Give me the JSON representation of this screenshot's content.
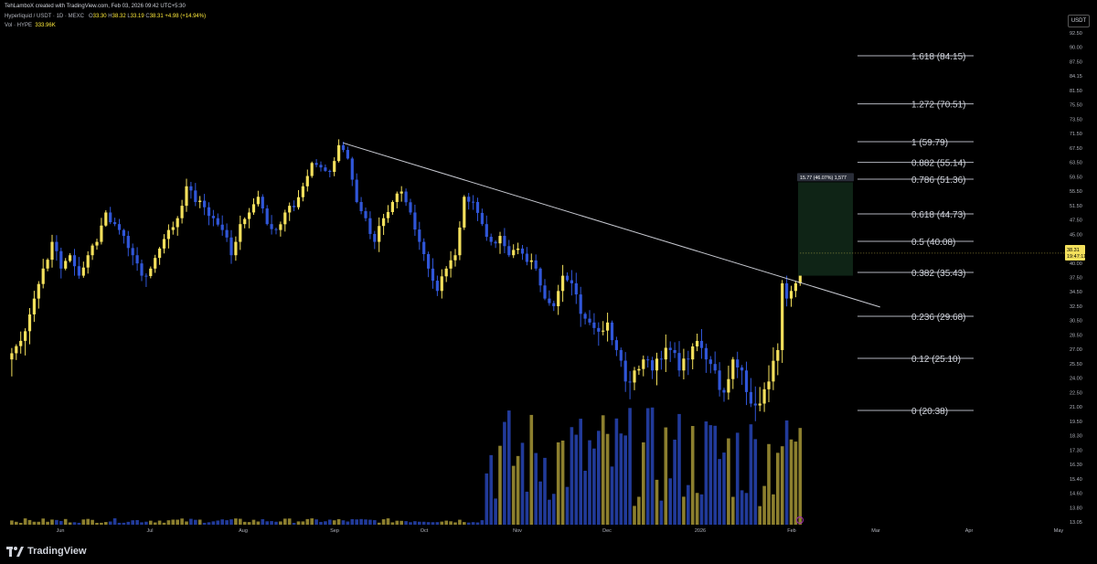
{
  "header": {
    "credit": "TehLamboX created with TradingView.com, Feb 03, 2026 09:42 UTC+5:30",
    "symbol": "Hyperliquid / USDT · 1D · MEXC",
    "ohlc": {
      "open_label": "O",
      "open": "33.30",
      "high_label": "H",
      "high": "38.32",
      "low_label": "L",
      "low": "33.19",
      "close_label": "C",
      "close": "38.31",
      "change": "+4.98 (+14.94%)"
    },
    "volume_label": "Vol · HYPE",
    "volume_value": "333.96K"
  },
  "currency": "USDT",
  "footer": {
    "brand": "TradingView"
  },
  "colors": {
    "up": "#f3e05c",
    "down": "#3056d8",
    "vol_up": "#8c7f2e",
    "vol_down": "#213a99",
    "fib_line": "#b2b5be",
    "trendline": "#c7c9d1",
    "measure_fill": "#0f2416",
    "price_tag": "#f3e05c"
  },
  "chart_data": {
    "type": "candlestick",
    "price_axis": {
      "ticks": [
        "92.50",
        "90.00",
        "87.50",
        "84.15",
        "81.50",
        "75.50",
        "73.50",
        "71.50",
        "67.50",
        "63.50",
        "59.50",
        "55.50",
        "51.50",
        "47.50",
        "45.00",
        "42.50",
        "40.00",
        "37.50",
        "34.50",
        "32.50",
        "30.50",
        "28.50",
        "27.00",
        "25.50",
        "24.00",
        "22.50",
        "21.00",
        "19.50",
        "18.30",
        "17.30",
        "16.30",
        "15.40",
        "14.60",
        "13.80",
        "13.05"
      ]
    },
    "time_axis": {
      "labels": [
        "Jun",
        "Jul",
        "Aug",
        "Sep",
        "Oct",
        "Nov",
        "Dec",
        "2026",
        "Feb",
        "Mar",
        "Apr",
        "May"
      ]
    },
    "candle_path": [
      [
        0,
        25
      ],
      [
        3,
        27
      ],
      [
        6,
        32
      ],
      [
        10,
        40
      ],
      [
        12,
        36
      ],
      [
        14,
        38
      ],
      [
        16,
        35
      ],
      [
        18,
        38
      ],
      [
        20,
        40
      ],
      [
        22,
        45
      ],
      [
        24,
        43
      ],
      [
        26,
        41
      ],
      [
        28,
        38
      ],
      [
        30,
        35
      ],
      [
        32,
        36
      ],
      [
        34,
        39
      ],
      [
        36,
        42
      ],
      [
        38,
        44
      ],
      [
        40,
        50
      ],
      [
        42,
        47
      ],
      [
        44,
        46
      ],
      [
        46,
        44
      ],
      [
        48,
        42
      ],
      [
        50,
        38
      ],
      [
        52,
        43
      ],
      [
        54,
        45
      ],
      [
        56,
        48
      ],
      [
        58,
        43
      ],
      [
        60,
        42
      ],
      [
        62,
        45
      ],
      [
        64,
        46
      ],
      [
        66,
        50
      ],
      [
        68,
        55
      ],
      [
        70,
        54
      ],
      [
        72,
        53
      ],
      [
        74,
        59
      ],
      [
        76,
        56
      ],
      [
        78,
        47
      ],
      [
        80,
        44
      ],
      [
        82,
        40
      ],
      [
        84,
        44
      ],
      [
        86,
        47
      ],
      [
        88,
        49
      ],
      [
        90,
        45
      ],
      [
        92,
        40
      ],
      [
        94,
        36
      ],
      [
        96,
        33
      ],
      [
        98,
        36
      ],
      [
        100,
        38
      ],
      [
        102,
        48
      ],
      [
        104,
        47
      ],
      [
        106,
        43
      ],
      [
        108,
        40
      ],
      [
        110,
        41
      ],
      [
        112,
        38
      ],
      [
        114,
        39
      ],
      [
        116,
        37
      ],
      [
        118,
        36
      ],
      [
        120,
        32
      ],
      [
        122,
        31
      ],
      [
        124,
        35
      ],
      [
        126,
        34
      ],
      [
        128,
        30
      ],
      [
        130,
        29
      ],
      [
        132,
        28
      ],
      [
        134,
        29
      ],
      [
        136,
        26
      ],
      [
        138,
        23
      ],
      [
        140,
        24
      ],
      [
        142,
        25
      ],
      [
        144,
        24
      ],
      [
        146,
        25
      ],
      [
        148,
        26
      ],
      [
        150,
        24
      ],
      [
        152,
        25
      ],
      [
        154,
        27
      ],
      [
        156,
        25
      ],
      [
        158,
        24
      ],
      [
        160,
        22
      ],
      [
        162,
        25
      ],
      [
        164,
        24
      ],
      [
        166,
        21
      ],
      [
        168,
        21
      ],
      [
        170,
        23
      ],
      [
        172,
        26
      ],
      [
        173,
        34
      ],
      [
        174,
        32
      ],
      [
        175,
        33
      ],
      [
        176,
        34
      ],
      [
        177,
        38.31
      ]
    ],
    "last_price": "38.31",
    "countdown": "19:47:11",
    "fibonacci": [
      {
        "level": "1.618",
        "price": "84.15",
        "label": "1.618 (84.15)"
      },
      {
        "level": "1.272",
        "price": "70.51",
        "label": "1.272 (70.51)"
      },
      {
        "level": "1",
        "price": "59.79",
        "label": "1 (59.79)"
      },
      {
        "level": "0.882",
        "price": "55.14",
        "label": "0.882 (55.14)"
      },
      {
        "level": "0.786",
        "price": "51.36",
        "label": "0.786 (51.36)"
      },
      {
        "level": "0.618",
        "price": "44.73",
        "label": "0.618 (44.73)"
      },
      {
        "level": "0.5",
        "price": "40.08",
        "label": "0.5 (40.08)"
      },
      {
        "level": "0.382",
        "price": "35.43",
        "label": "0.382 (35.43)"
      },
      {
        "level": "0.236",
        "price": "29.68",
        "label": "0.236 (29.68)"
      },
      {
        "level": "0.12",
        "price": "25.10",
        "label": "0.12 (25.10)"
      },
      {
        "level": "0",
        "price": "20.38",
        "label": "0 (20.38)"
      }
    ],
    "measure": {
      "label": "15.77 (46.07%) 1,577",
      "from_price": 35.0,
      "to_price": 50.77
    },
    "trendline": {
      "from": {
        "day": 75,
        "price": 59.5
      },
      "to": {
        "day": 182,
        "price": 33.2
      }
    },
    "fib_anchor_days": [
      188,
      212
    ]
  }
}
